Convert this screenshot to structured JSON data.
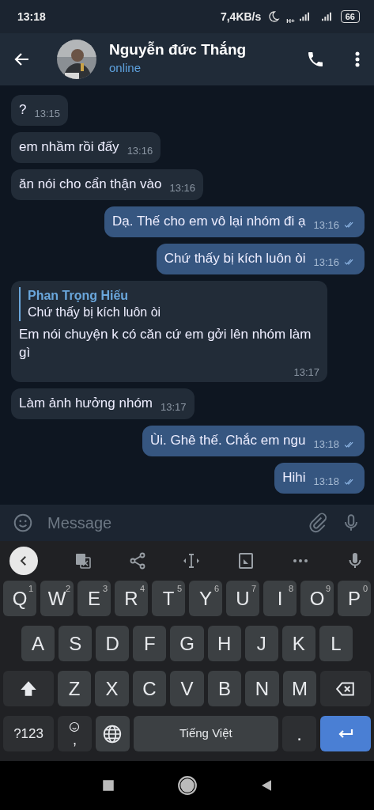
{
  "status_bar": {
    "time": "13:18",
    "speed": "7,4KB/s",
    "network": "H+",
    "battery": "66"
  },
  "header": {
    "name": "Nguyễn đức Thắng",
    "status": "online"
  },
  "messages": [
    {
      "kind": "in",
      "text": "?",
      "time": "13:15"
    },
    {
      "kind": "in",
      "text": "em nhầm rồi đấy",
      "time": "13:16"
    },
    {
      "kind": "in",
      "text": "ăn nói cho cẩn thận vào",
      "time": "13:16"
    },
    {
      "kind": "out",
      "text": "Dạ. Thế cho em vô lại nhóm đi ạ",
      "time": "13:16",
      "read": true
    },
    {
      "kind": "out",
      "text": "Chứ thấy bị kích luôn òi",
      "time": "13:16",
      "read": true
    },
    {
      "kind": "in",
      "text": "Em nói chuyện k có căn cứ em gởi lên nhóm làm gì",
      "time": "13:17",
      "reply": {
        "author": "Phan Trọng Hiếu",
        "text": "Chứ thấy bị kích luôn òi"
      }
    },
    {
      "kind": "in",
      "text": "Làm ảnh hưởng nhóm",
      "time": "13:17"
    },
    {
      "kind": "out",
      "text": "Ùi. Ghê thế. Chắc em ngu",
      "time": "13:18",
      "read": true
    },
    {
      "kind": "out",
      "text": "Hihi",
      "time": "13:18",
      "read": true
    }
  ],
  "composer": {
    "placeholder": "Message"
  },
  "keyboard": {
    "letter_row": [
      {
        "kind": "letter",
        "label": "Q",
        "hint": "1"
      },
      {
        "kind": "letter",
        "label": "W",
        "hint": "2"
      },
      {
        "kind": "letter",
        "label": "E",
        "hint": "3"
      },
      {
        "kind": "letter",
        "label": "R",
        "hint": "4"
      },
      {
        "kind": "letter",
        "label": "T",
        "hint": "5"
      },
      {
        "kind": "letter",
        "label": "Y",
        "hint": "6"
      },
      {
        "kind": "letter",
        "label": "U",
        "hint": "7"
      },
      {
        "kind": "letter",
        "label": "I",
        "hint": "8"
      },
      {
        "kind": "letter",
        "label": "O",
        "hint": "9"
      },
      {
        "kind": "letter",
        "label": "P",
        "hint": "0"
      }
    ],
    "home_row": [
      {
        "kind": "letter",
        "label": "A"
      },
      {
        "kind": "letter",
        "label": "S"
      },
      {
        "kind": "letter",
        "label": "D"
      },
      {
        "kind": "letter",
        "label": "F"
      },
      {
        "kind": "letter",
        "label": "G"
      },
      {
        "kind": "letter",
        "label": "H"
      },
      {
        "kind": "letter",
        "label": "J"
      },
      {
        "kind": "letter",
        "label": "K"
      },
      {
        "kind": "letter",
        "label": "L"
      }
    ],
    "shift_row": [
      {
        "kind": "shift"
      },
      {
        "kind": "letter",
        "label": "Z"
      },
      {
        "kind": "letter",
        "label": "X"
      },
      {
        "kind": "letter",
        "label": "C"
      },
      {
        "kind": "letter",
        "label": "V"
      },
      {
        "kind": "letter",
        "label": "B"
      },
      {
        "kind": "letter",
        "label": "N"
      },
      {
        "kind": "letter",
        "label": "M"
      },
      {
        "kind": "backspace"
      }
    ],
    "bottom_row": [
      {
        "kind": "symbols",
        "label": "?123"
      },
      {
        "kind": "emoji",
        "label": ","
      },
      {
        "kind": "globe"
      },
      {
        "kind": "space",
        "label": "Tiếng Việt"
      },
      {
        "kind": "period",
        "label": "."
      },
      {
        "kind": "enter"
      }
    ]
  }
}
